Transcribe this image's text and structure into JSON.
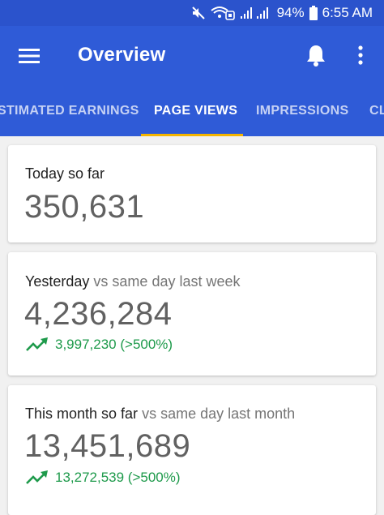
{
  "status_bar": {
    "battery_percent": "94%",
    "time": "6:55 AM",
    "icons": [
      "mute-icon",
      "wifi-calling-icon",
      "signal-icon",
      "battery-icon"
    ]
  },
  "app_bar": {
    "title": "Overview",
    "icons": [
      "menu-icon",
      "bell-icon",
      "more-vert-icon"
    ]
  },
  "tabs": [
    {
      "label": "ESTIMATED EARNINGS",
      "active": false
    },
    {
      "label": "PAGE VIEWS",
      "active": true
    },
    {
      "label": "IMPRESSIONS",
      "active": false
    },
    {
      "label": "CLICKS",
      "active": false
    }
  ],
  "cards": {
    "today": {
      "label": "Today so far",
      "value": "350,631"
    },
    "yesterday": {
      "label": "Yesterday",
      "comparison": "vs same day last week",
      "value": "4,236,284",
      "change": "3,997,230 (>500%)"
    },
    "month": {
      "label": "This month so far",
      "comparison": "vs same day last month",
      "value": "13,451,689",
      "change": "13,272,539 (>500%)"
    }
  },
  "colors": {
    "app_bar": "#2f5bd7",
    "status_bar": "#2b53cc",
    "tab_indicator": "#f4b400",
    "trend_up": "#1e9a4b"
  }
}
